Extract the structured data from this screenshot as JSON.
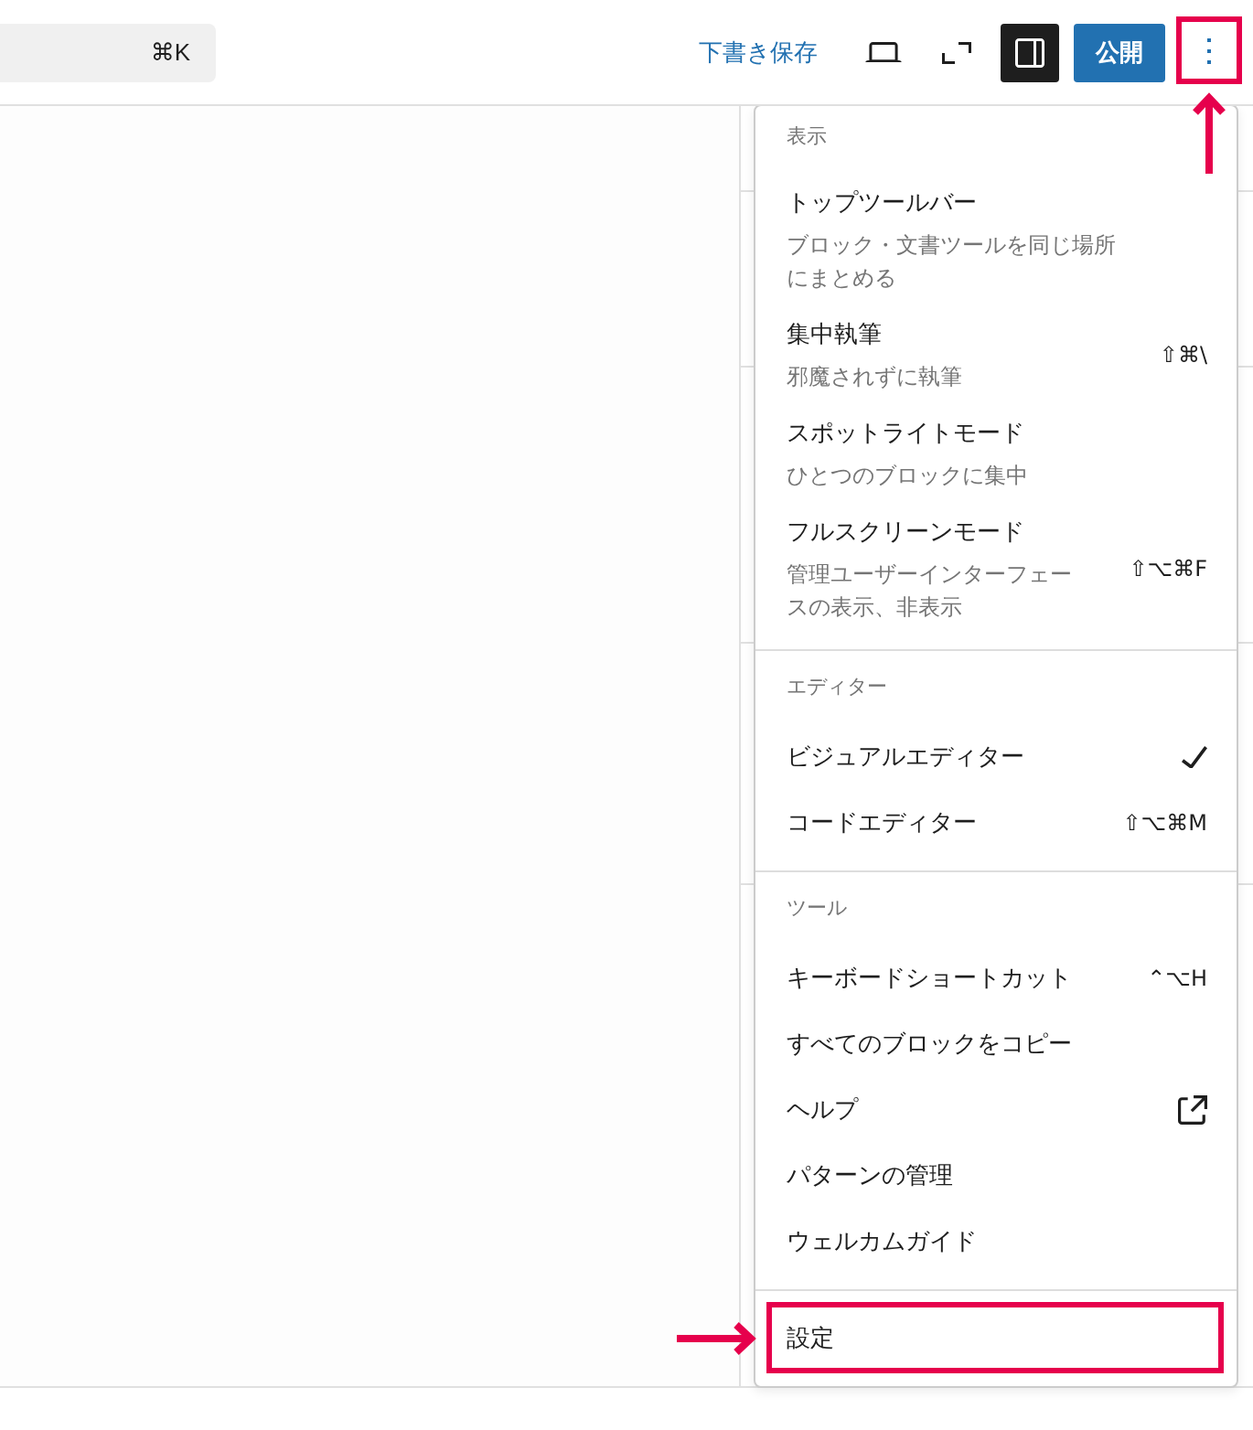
{
  "toolbar": {
    "command_bar": {
      "shortcut": "⌘K"
    },
    "save_draft": "下書き保存",
    "icon_buttons": [
      {
        "kind": "laptop",
        "pressed": false
      },
      {
        "kind": "expand",
        "pressed": false
      },
      {
        "kind": "sidebar",
        "pressed": true
      }
    ],
    "publish": "公開",
    "options_button": {
      "expanded": true,
      "callout": true
    }
  },
  "menu": {
    "sections": [
      {
        "label": "表示",
        "items": [
          {
            "kind": "action",
            "label": "トップツールバー",
            "description": "ブロック・文書ツールを同じ場所にまとめる"
          },
          {
            "kind": "action",
            "label": "集中執筆",
            "description": "邪魔されずに執筆",
            "shortcut": "⇧⌘\\"
          },
          {
            "kind": "action",
            "label": "スポットライトモード",
            "description": "ひとつのブロックに集中"
          },
          {
            "kind": "action",
            "label": "フルスクリーンモード",
            "description": "管理ユーザーインターフェースの表示、非表示",
            "shortcut": "⇧⌥⌘F"
          }
        ]
      },
      {
        "label": "エディター",
        "items": [
          {
            "kind": "radio",
            "label": "ビジュアルエディター",
            "selected": true
          },
          {
            "kind": "radio",
            "label": "コードエディター",
            "selected": false,
            "shortcut": "⇧⌥⌘M"
          }
        ]
      },
      {
        "label": "ツール",
        "items": [
          {
            "kind": "action",
            "label": "キーボードショートカット",
            "shortcut": "⌃⌥H"
          },
          {
            "kind": "action",
            "label": "すべてのブロックをコピー"
          },
          {
            "kind": "link",
            "label": "ヘルプ"
          },
          {
            "kind": "action",
            "label": "パターンの管理"
          },
          {
            "kind": "action",
            "label": "ウェルカムガイド"
          }
        ]
      },
      {
        "items": [
          {
            "kind": "action",
            "label": "設定",
            "callout": true
          }
        ]
      }
    ]
  }
}
